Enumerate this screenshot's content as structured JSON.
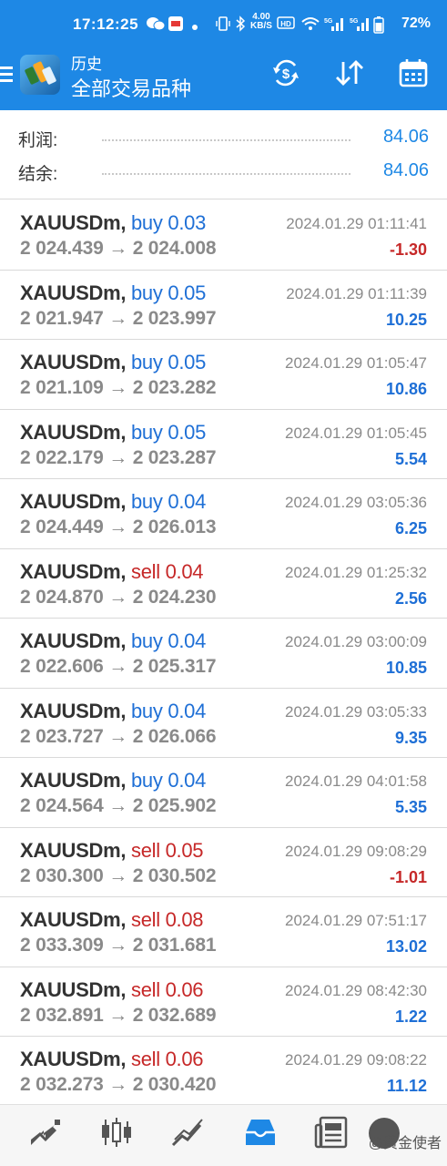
{
  "status_bar": {
    "time": "17:12:25",
    "network_speed": "4.00 KB/S",
    "battery": "72%"
  },
  "header": {
    "subtitle": "历史",
    "title": "全部交易品种",
    "icons": [
      "menu-icon",
      "app-logo",
      "currency-exchange-icon",
      "sort-icon",
      "calendar-icon"
    ]
  },
  "summary": {
    "profit_label": "利润:",
    "profit_value": "84.06",
    "balance_label": "结余:",
    "balance_value": "84.06"
  },
  "deals": [
    {
      "symbol": "XAUUSDm,",
      "side": "buy",
      "volume": "0.03",
      "prices": "2 024.439 → 2 024.008",
      "time": "2024.01.29 01:11:41",
      "profit": "-1.30"
    },
    {
      "symbol": "XAUUSDm,",
      "side": "buy",
      "volume": "0.05",
      "prices": "2 021.947 → 2 023.997",
      "time": "2024.01.29 01:11:39",
      "profit": "10.25"
    },
    {
      "symbol": "XAUUSDm,",
      "side": "buy",
      "volume": "0.05",
      "prices": "2 021.109 → 2 023.282",
      "time": "2024.01.29 01:05:47",
      "profit": "10.86"
    },
    {
      "symbol": "XAUUSDm,",
      "side": "buy",
      "volume": "0.05",
      "prices": "2 022.179 → 2 023.287",
      "time": "2024.01.29 01:05:45",
      "profit": "5.54"
    },
    {
      "symbol": "XAUUSDm,",
      "side": "buy",
      "volume": "0.04",
      "prices": "2 024.449 → 2 026.013",
      "time": "2024.01.29 03:05:36",
      "profit": "6.25"
    },
    {
      "symbol": "XAUUSDm,",
      "side": "sell",
      "volume": "0.04",
      "prices": "2 024.870 → 2 024.230",
      "time": "2024.01.29 01:25:32",
      "profit": "2.56"
    },
    {
      "symbol": "XAUUSDm,",
      "side": "buy",
      "volume": "0.04",
      "prices": "2 022.606 → 2 025.317",
      "time": "2024.01.29 03:00:09",
      "profit": "10.85"
    },
    {
      "symbol": "XAUUSDm,",
      "side": "buy",
      "volume": "0.04",
      "prices": "2 023.727 → 2 026.066",
      "time": "2024.01.29 03:05:33",
      "profit": "9.35"
    },
    {
      "symbol": "XAUUSDm,",
      "side": "buy",
      "volume": "0.04",
      "prices": "2 024.564 → 2 025.902",
      "time": "2024.01.29 04:01:58",
      "profit": "5.35"
    },
    {
      "symbol": "XAUUSDm,",
      "side": "sell",
      "volume": "0.05",
      "prices": "2 030.300 → 2 030.502",
      "time": "2024.01.29 09:08:29",
      "profit": "-1.01"
    },
    {
      "symbol": "XAUUSDm,",
      "side": "sell",
      "volume": "0.08",
      "prices": "2 033.309 → 2 031.681",
      "time": "2024.01.29 07:51:17",
      "profit": "13.02"
    },
    {
      "symbol": "XAUUSDm,",
      "side": "sell",
      "volume": "0.06",
      "prices": "2 032.891 → 2 032.689",
      "time": "2024.01.29 08:42:30",
      "profit": "1.22"
    },
    {
      "symbol": "XAUUSDm,",
      "side": "sell",
      "volume": "0.06",
      "prices": "2 032.273 → 2 030.420",
      "time": "2024.01.29 09:08:22",
      "profit": "11.12"
    }
  ],
  "bottom_nav": {
    "items": [
      "quotes-icon",
      "chart-icon",
      "trade-icon",
      "history-icon",
      "news-icon"
    ],
    "active": "history-icon",
    "watermark": "@黄金使者"
  },
  "colors": {
    "accent": "#1e88e5",
    "buy": "#1e6fd6",
    "sell": "#c62828",
    "muted": "#8a8a8a"
  }
}
